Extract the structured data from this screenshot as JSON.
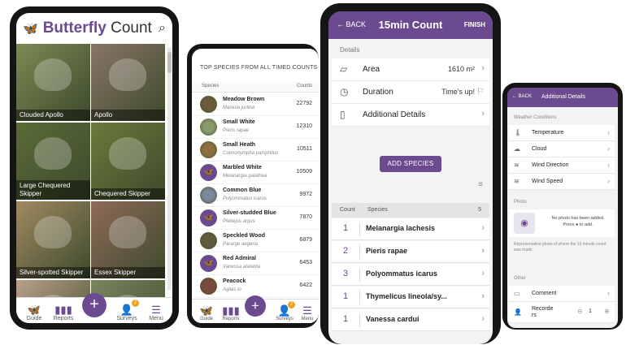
{
  "colors": {
    "brand": "#6b4a8f",
    "badge": "#f0a020"
  },
  "guide_screen": {
    "title_part1": "Butterfly",
    "title_part2": "Count",
    "tiles": [
      {
        "label": "Clouded Apollo",
        "bg": "#7c8a55"
      },
      {
        "label": "Apollo",
        "bg": "#8a7668"
      },
      {
        "label": "Large Chequered Skipper",
        "bg": "#5a6b38"
      },
      {
        "label": "Chequered Skipper",
        "bg": "#6c7a3c"
      },
      {
        "label": "Silver-spotted Skipper",
        "bg": "#a08a62"
      },
      {
        "label": "Essex Skipper",
        "bg": "#8e6a5a"
      },
      {
        "label": "",
        "bg": "#b9a08a"
      },
      {
        "label": "",
        "bg": "#7a8460"
      }
    ],
    "nav": {
      "guide": "Guide",
      "reports": "Reports",
      "surveys": "Surveys",
      "menu": "Menu",
      "surveys_badge": "2"
    }
  },
  "top_species": {
    "heading": "TOP SPECIES FROM ALL TIMED COUNTS",
    "col_species": "Species",
    "col_counts": "Counts",
    "rows": [
      {
        "name": "Meadow Brown",
        "latin": "Maniola jurtina",
        "count": "22792",
        "photo": true,
        "color": "#6e5a3c"
      },
      {
        "name": "Small White",
        "latin": "Pieris rapae",
        "count": "12310",
        "photo": true,
        "color": "#8a9a6c"
      },
      {
        "name": "Small Heath",
        "latin": "Coenonympha pamphilus",
        "count": "10511",
        "photo": true,
        "color": "#8c7040"
      },
      {
        "name": "Marbled White",
        "latin": "Melanargia galathea",
        "count": "10509",
        "photo": false,
        "color": "#6b4a8f"
      },
      {
        "name": "Common Blue",
        "latin": "Polyommatus icarus",
        "count": "9972",
        "photo": true,
        "color": "#7a8a9c"
      },
      {
        "name": "Silver-studded Blue",
        "latin": "Plebejus argus",
        "count": "7870",
        "photo": false,
        "color": "#6b4a8f"
      },
      {
        "name": "Speckled Wood",
        "latin": "Pararge aegeria",
        "count": "6879",
        "photo": true,
        "color": "#5e5a3a"
      },
      {
        "name": "Red Admiral",
        "latin": "Vanessa atalanta",
        "count": "6453",
        "photo": false,
        "color": "#6b4a8f"
      },
      {
        "name": "Peacock",
        "latin": "Aglais io",
        "count": "6422",
        "photo": true,
        "color": "#7a4a3a"
      }
    ],
    "nav": {
      "guide": "Guide",
      "reports": "Reports",
      "surveys": "Surveys",
      "menu": "Menu",
      "surveys_badge": "2"
    }
  },
  "count_screen": {
    "back": "BACK",
    "title": "15min Count",
    "finish": "FINISH",
    "section_details": "Details",
    "area_label": "Area",
    "area_value": "1610 m²",
    "duration_label": "Duration",
    "duration_value": "Time's up!",
    "additional_label": "Additional Details",
    "add_species": "ADD SPECIES",
    "col_count": "Count",
    "col_species": "Species",
    "species_total": "5",
    "rows": [
      {
        "count": "1",
        "species": "Melanargia lachesis"
      },
      {
        "count": "2",
        "species": "Pieris rapae"
      },
      {
        "count": "3",
        "species": "Polyommatus icarus"
      },
      {
        "count": "1",
        "species": "Thymelicus lineola/sy..."
      },
      {
        "count": "1",
        "species": "Vanessa cardui"
      }
    ]
  },
  "additional_details": {
    "back": "BACK",
    "title": "Additional Details",
    "section_weather": "Weather Conditions",
    "weather_rows": [
      "Temperature",
      "Cloud",
      "Wind Direction",
      "Wind Speed"
    ],
    "section_photo": "Photo",
    "photo_msg_1": "No photo has been added.",
    "photo_msg_2": "Press",
    "photo_msg_3": "to add.",
    "photo_hint": "Representative photo of where the 15 minute count was made",
    "section_other": "Other",
    "comment": "Comment",
    "recorders": "Recorders",
    "recorders_count": "1"
  }
}
